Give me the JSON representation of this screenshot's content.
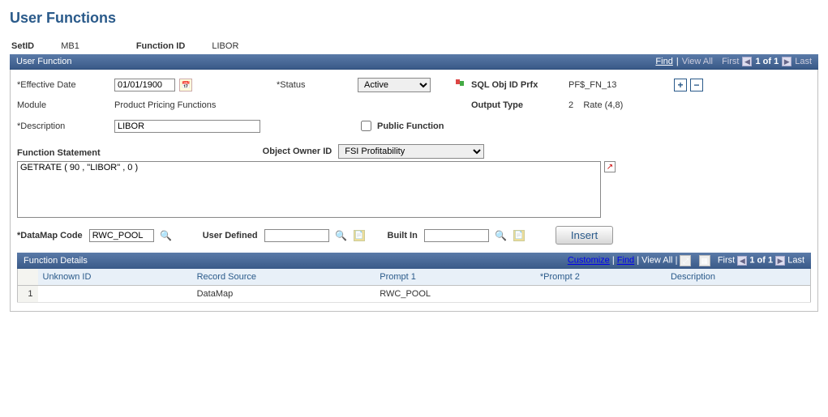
{
  "page_title": "User Functions",
  "header": {
    "setid_label": "SetID",
    "setid_value": "MB1",
    "function_id_label": "Function ID",
    "function_id_value": "LIBOR"
  },
  "panel": {
    "title": "User Function",
    "nav": {
      "find": "Find",
      "view_all": "View All",
      "first": "First",
      "pos": "1 of 1",
      "last": "Last"
    }
  },
  "form": {
    "eff_date_label": "Effective Date",
    "eff_date_value": "01/01/1900",
    "status_label": "Status",
    "status_value": "Active",
    "sql_prefix_label": "SQL Obj ID Prfx",
    "sql_prefix_value": "PF$_FN_13",
    "module_label": "Module",
    "module_value": "Product Pricing Functions",
    "output_type_label": "Output Type",
    "output_type_code": "2",
    "output_type_value": "Rate (4,8)",
    "description_label": "Description",
    "description_value": "LIBOR",
    "public_fn_label": "Public Function",
    "stmt_heading": "Function Statement",
    "owner_label": "Object Owner ID",
    "owner_value": "FSI Profitability",
    "stmt_value": "GETRATE ( 90 , \"LIBOR\" , 0 )",
    "datamap_label": "DataMap Code",
    "datamap_value": "RWC_POOL",
    "user_defined_label": "User Defined",
    "user_defined_value": "",
    "builtin_label": "Built In",
    "builtin_value": "",
    "insert_label": "Insert"
  },
  "details": {
    "title": "Function Details",
    "nav": {
      "customize": "Customize",
      "find": "Find",
      "view_all": "View All",
      "first": "First",
      "pos": "1 of 1",
      "last": "Last"
    },
    "columns": {
      "unknown_id": "Unknown ID",
      "record_source": "Record Source",
      "prompt1": "Prompt 1",
      "prompt2": "*Prompt 2",
      "description": "Description"
    },
    "row": {
      "num": "1",
      "unknown_id": "",
      "record_source": "DataMap",
      "prompt1": "RWC_POOL",
      "prompt2": "",
      "description": ""
    }
  }
}
